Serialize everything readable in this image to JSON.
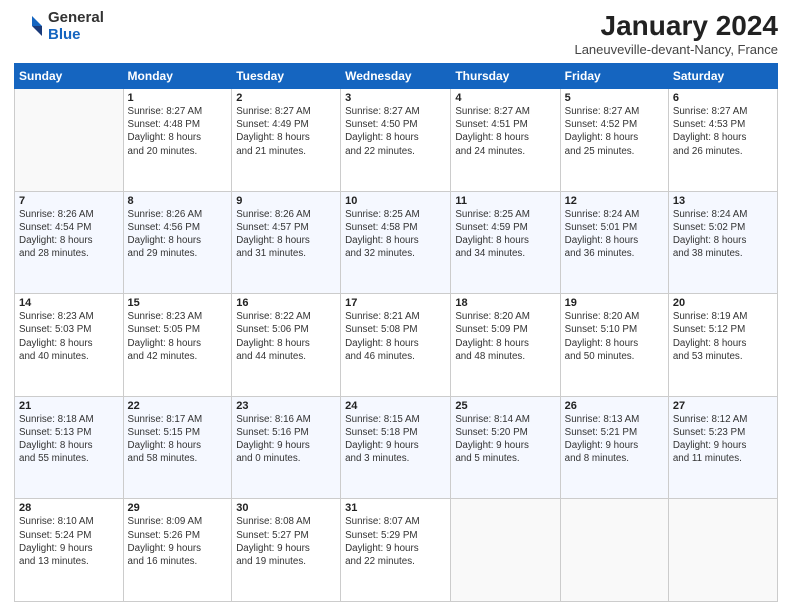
{
  "header": {
    "logo_general": "General",
    "logo_blue": "Blue",
    "month_year": "January 2024",
    "location": "Laneuveville-devant-Nancy, France"
  },
  "days": [
    "Sunday",
    "Monday",
    "Tuesday",
    "Wednesday",
    "Thursday",
    "Friday",
    "Saturday"
  ],
  "weeks": [
    [
      {
        "date": "",
        "info": ""
      },
      {
        "date": "1",
        "info": "Sunrise: 8:27 AM\nSunset: 4:48 PM\nDaylight: 8 hours\nand 20 minutes."
      },
      {
        "date": "2",
        "info": "Sunrise: 8:27 AM\nSunset: 4:49 PM\nDaylight: 8 hours\nand 21 minutes."
      },
      {
        "date": "3",
        "info": "Sunrise: 8:27 AM\nSunset: 4:50 PM\nDaylight: 8 hours\nand 22 minutes."
      },
      {
        "date": "4",
        "info": "Sunrise: 8:27 AM\nSunset: 4:51 PM\nDaylight: 8 hours\nand 24 minutes."
      },
      {
        "date": "5",
        "info": "Sunrise: 8:27 AM\nSunset: 4:52 PM\nDaylight: 8 hours\nand 25 minutes."
      },
      {
        "date": "6",
        "info": "Sunrise: 8:27 AM\nSunset: 4:53 PM\nDaylight: 8 hours\nand 26 minutes."
      }
    ],
    [
      {
        "date": "7",
        "info": "Sunrise: 8:26 AM\nSunset: 4:54 PM\nDaylight: 8 hours\nand 28 minutes."
      },
      {
        "date": "8",
        "info": "Sunrise: 8:26 AM\nSunset: 4:56 PM\nDaylight: 8 hours\nand 29 minutes."
      },
      {
        "date": "9",
        "info": "Sunrise: 8:26 AM\nSunset: 4:57 PM\nDaylight: 8 hours\nand 31 minutes."
      },
      {
        "date": "10",
        "info": "Sunrise: 8:25 AM\nSunset: 4:58 PM\nDaylight: 8 hours\nand 32 minutes."
      },
      {
        "date": "11",
        "info": "Sunrise: 8:25 AM\nSunset: 4:59 PM\nDaylight: 8 hours\nand 34 minutes."
      },
      {
        "date": "12",
        "info": "Sunrise: 8:24 AM\nSunset: 5:01 PM\nDaylight: 8 hours\nand 36 minutes."
      },
      {
        "date": "13",
        "info": "Sunrise: 8:24 AM\nSunset: 5:02 PM\nDaylight: 8 hours\nand 38 minutes."
      }
    ],
    [
      {
        "date": "14",
        "info": "Sunrise: 8:23 AM\nSunset: 5:03 PM\nDaylight: 8 hours\nand 40 minutes."
      },
      {
        "date": "15",
        "info": "Sunrise: 8:23 AM\nSunset: 5:05 PM\nDaylight: 8 hours\nand 42 minutes."
      },
      {
        "date": "16",
        "info": "Sunrise: 8:22 AM\nSunset: 5:06 PM\nDaylight: 8 hours\nand 44 minutes."
      },
      {
        "date": "17",
        "info": "Sunrise: 8:21 AM\nSunset: 5:08 PM\nDaylight: 8 hours\nand 46 minutes."
      },
      {
        "date": "18",
        "info": "Sunrise: 8:20 AM\nSunset: 5:09 PM\nDaylight: 8 hours\nand 48 minutes."
      },
      {
        "date": "19",
        "info": "Sunrise: 8:20 AM\nSunset: 5:10 PM\nDaylight: 8 hours\nand 50 minutes."
      },
      {
        "date": "20",
        "info": "Sunrise: 8:19 AM\nSunset: 5:12 PM\nDaylight: 8 hours\nand 53 minutes."
      }
    ],
    [
      {
        "date": "21",
        "info": "Sunrise: 8:18 AM\nSunset: 5:13 PM\nDaylight: 8 hours\nand 55 minutes."
      },
      {
        "date": "22",
        "info": "Sunrise: 8:17 AM\nSunset: 5:15 PM\nDaylight: 8 hours\nand 58 minutes."
      },
      {
        "date": "23",
        "info": "Sunrise: 8:16 AM\nSunset: 5:16 PM\nDaylight: 9 hours\nand 0 minutes."
      },
      {
        "date": "24",
        "info": "Sunrise: 8:15 AM\nSunset: 5:18 PM\nDaylight: 9 hours\nand 3 minutes."
      },
      {
        "date": "25",
        "info": "Sunrise: 8:14 AM\nSunset: 5:20 PM\nDaylight: 9 hours\nand 5 minutes."
      },
      {
        "date": "26",
        "info": "Sunrise: 8:13 AM\nSunset: 5:21 PM\nDaylight: 9 hours\nand 8 minutes."
      },
      {
        "date": "27",
        "info": "Sunrise: 8:12 AM\nSunset: 5:23 PM\nDaylight: 9 hours\nand 11 minutes."
      }
    ],
    [
      {
        "date": "28",
        "info": "Sunrise: 8:10 AM\nSunset: 5:24 PM\nDaylight: 9 hours\nand 13 minutes."
      },
      {
        "date": "29",
        "info": "Sunrise: 8:09 AM\nSunset: 5:26 PM\nDaylight: 9 hours\nand 16 minutes."
      },
      {
        "date": "30",
        "info": "Sunrise: 8:08 AM\nSunset: 5:27 PM\nDaylight: 9 hours\nand 19 minutes."
      },
      {
        "date": "31",
        "info": "Sunrise: 8:07 AM\nSunset: 5:29 PM\nDaylight: 9 hours\nand 22 minutes."
      },
      {
        "date": "",
        "info": ""
      },
      {
        "date": "",
        "info": ""
      },
      {
        "date": "",
        "info": ""
      }
    ]
  ]
}
